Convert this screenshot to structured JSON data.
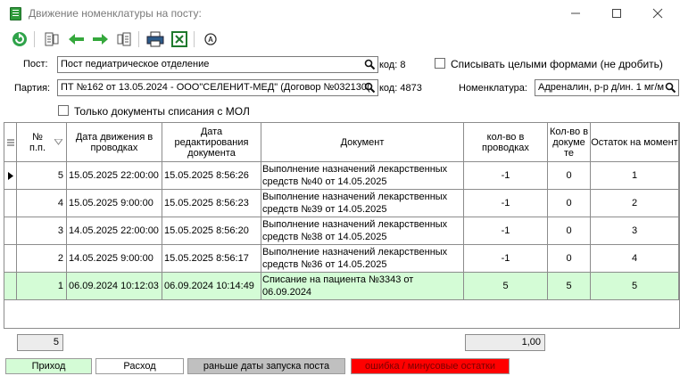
{
  "window": {
    "title": "Движение номенклатуры на посту:"
  },
  "filters": {
    "post_label": "Пост:",
    "post_value": "Пост педиатрическое отделение",
    "post_code": "код: 8",
    "whole_forms_label": "Списывать целыми формами (не дробить)",
    "batch_label": "Партия:",
    "batch_value": "ПТ №162 от 13.05.2024 - ООО\"СЕЛЕНИТ-МЕД\" (Договор №032130(",
    "batch_code": "код: 4873",
    "nomenclature_label": "Номенклатура:",
    "nomenclature_value": "Адреналин, р-р д/ин. 1 мг/м",
    "only_writeoff_label": "Только документы списания с МОЛ"
  },
  "table": {
    "headers": {
      "num": "№ п.п.",
      "date_move": "Дата движения в проводках",
      "date_edit": "Дата редактирования документа",
      "document": "Документ",
      "qty_post": "кол-во в проводках",
      "qty_doc": "Кол-во в докуме те",
      "balance": "Остаток на момент"
    },
    "rows": [
      {
        "num": "5",
        "date_move": "15.05.2025 22:00:00",
        "date_edit": "15.05.2025 8:56:26",
        "document": "Выполнение назначений лекарственных средств №40 от 14.05.2025",
        "qty_post": "-1",
        "qty_doc": "0",
        "balance": "1"
      },
      {
        "num": "4",
        "date_move": "15.05.2025 9:00:00",
        "date_edit": "15.05.2025 8:56:23",
        "document": "Выполнение назначений лекарственных средств №39 от 14.05.2025",
        "qty_post": "-1",
        "qty_doc": "0",
        "balance": "2"
      },
      {
        "num": "3",
        "date_move": "14.05.2025 22:00:00",
        "date_edit": "15.05.2025 8:56:20",
        "document": "Выполнение назначений лекарственных средств №38 от 14.05.2025",
        "qty_post": "-1",
        "qty_doc": "0",
        "balance": "3"
      },
      {
        "num": "2",
        "date_move": "14.05.2025 9:00:00",
        "date_edit": "15.05.2025 8:56:17",
        "document": "Выполнение назначений лекарственных средств №36 от 14.05.2025",
        "qty_post": "-1",
        "qty_doc": "0",
        "balance": "4"
      },
      {
        "num": "1",
        "date_move": "06.09.2024 10:12:03",
        "date_edit": "06.09.2024 10:14:49",
        "document": "Списание на пациента №3343 от 06.09.2024",
        "qty_post": "5",
        "qty_doc": "5",
        "balance": "5"
      }
    ]
  },
  "footer": {
    "count": "5",
    "sum": "1,00"
  },
  "legend": {
    "income": "Приход",
    "expense": "Расход",
    "before_launch": "раньше даты запуска поста",
    "error": "ошибка / минусовые остатки"
  },
  "colors": {
    "income": "#d4fcd6",
    "expense": "#ffffff",
    "before_launch": "#c0c0c0",
    "error": "#ff0000",
    "toolbar_green": "#2fa34a"
  }
}
